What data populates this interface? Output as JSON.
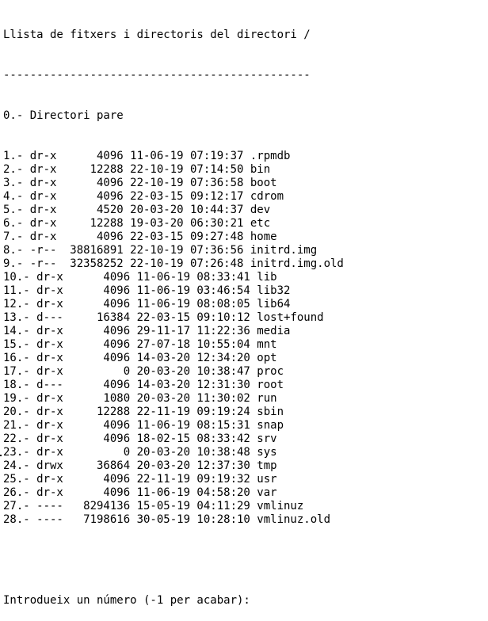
{
  "terminal": {
    "title_line": "Llista de fitxers i directoris del directori /",
    "separator_line": "----------------------------------------------",
    "parent_line": "0.- Directori pare",
    "entries": [
      "1.- dr-x      4096 11-06-19 07:19:37 .rpmdb",
      "2.- dr-x     12288 22-10-19 07:14:50 bin",
      "3.- dr-x      4096 22-10-19 07:36:58 boot",
      "4.- dr-x      4096 22-03-15 09:12:17 cdrom",
      "5.- dr-x      4520 20-03-20 10:44:37 dev",
      "6.- dr-x     12288 19-03-20 06:30:21 etc",
      "7.- dr-x      4096 22-03-15 09:27:48 home",
      "8.- -r--  38816891 22-10-19 07:36:56 initrd.img",
      "9.- -r--  32358252 22-10-19 07:26:48 initrd.img.old",
      "10.- dr-x      4096 11-06-19 08:33:41 lib",
      "11.- dr-x      4096 11-06-19 03:46:54 lib32",
      "12.- dr-x      4096 11-06-19 08:08:05 lib64",
      "13.- d---     16384 22-03-15 09:10:12 lost+found",
      "14.- dr-x      4096 29-11-17 11:22:36 media",
      "15.- dr-x      4096 27-07-18 10:55:04 mnt",
      "16.- dr-x      4096 14-03-20 12:34:20 opt",
      "17.- dr-x         0 20-03-20 10:38:47 proc",
      "18.- d---      4096 14-03-20 12:31:30 root",
      "19.- dr-x      1080 20-03-20 11:30:02 run",
      "20.- dr-x     12288 22-11-19 09:19:24 sbin",
      "21.- dr-x      4096 11-06-19 08:15:31 snap",
      "22.- dr-x      4096 18-02-15 08:33:42 srv",
      "23.- dr-x         0 20-03-20 10:38:48 sys",
      "24.- drwx     36864 20-03-20 12:37:30 tmp",
      "25.- dr-x      4096 22-11-19 09:19:32 usr",
      "26.- dr-x      4096 11-06-19 04:58:20 var",
      "27.- ----   8294136 15-05-19 04:11:29 vmlinuz",
      "28.- ----   7198616 30-05-19 10:28:10 vmlinuz.old"
    ],
    "prompt_line": "Introdueix un número (-1 per acabar):"
  }
}
